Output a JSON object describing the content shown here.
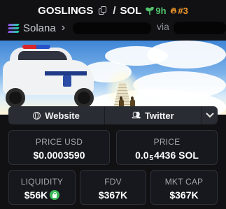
{
  "header": {
    "token_symbol": "GOSLINGS",
    "separator": "/",
    "quote_symbol": "SOL",
    "age": "9h",
    "rank": "#3",
    "age_color": "#53c46c",
    "rank_color": "#f39a2b",
    "icons": [
      "copy-icon",
      "seedling-icon",
      "flame-icon"
    ]
  },
  "chain": {
    "name": "Solana",
    "via_label": "via",
    "icons": [
      "solana-logo-icon",
      "chevron-right-icon"
    ]
  },
  "links": {
    "website_label": "Website",
    "twitter_label": "Twitter",
    "more_label": "⌄",
    "icons": [
      "globe-icon",
      "users-icon",
      "chevron-down-icon"
    ]
  },
  "stats": {
    "price_usd": {
      "label": "PRICE USD",
      "value": "$0.0003590"
    },
    "price_native": {
      "label": "PRICE",
      "prefix": "0.0",
      "zeros": "5",
      "digits": "4436",
      "unit": "SOL"
    },
    "liquidity": {
      "label": "LIQUIDITY",
      "value": "$56K",
      "locked_icon": "lock-icon"
    },
    "fdv": {
      "label": "FDV",
      "value": "$367K"
    },
    "mkt_cap": {
      "label": "MKT CAP",
      "value": "$367K"
    }
  }
}
